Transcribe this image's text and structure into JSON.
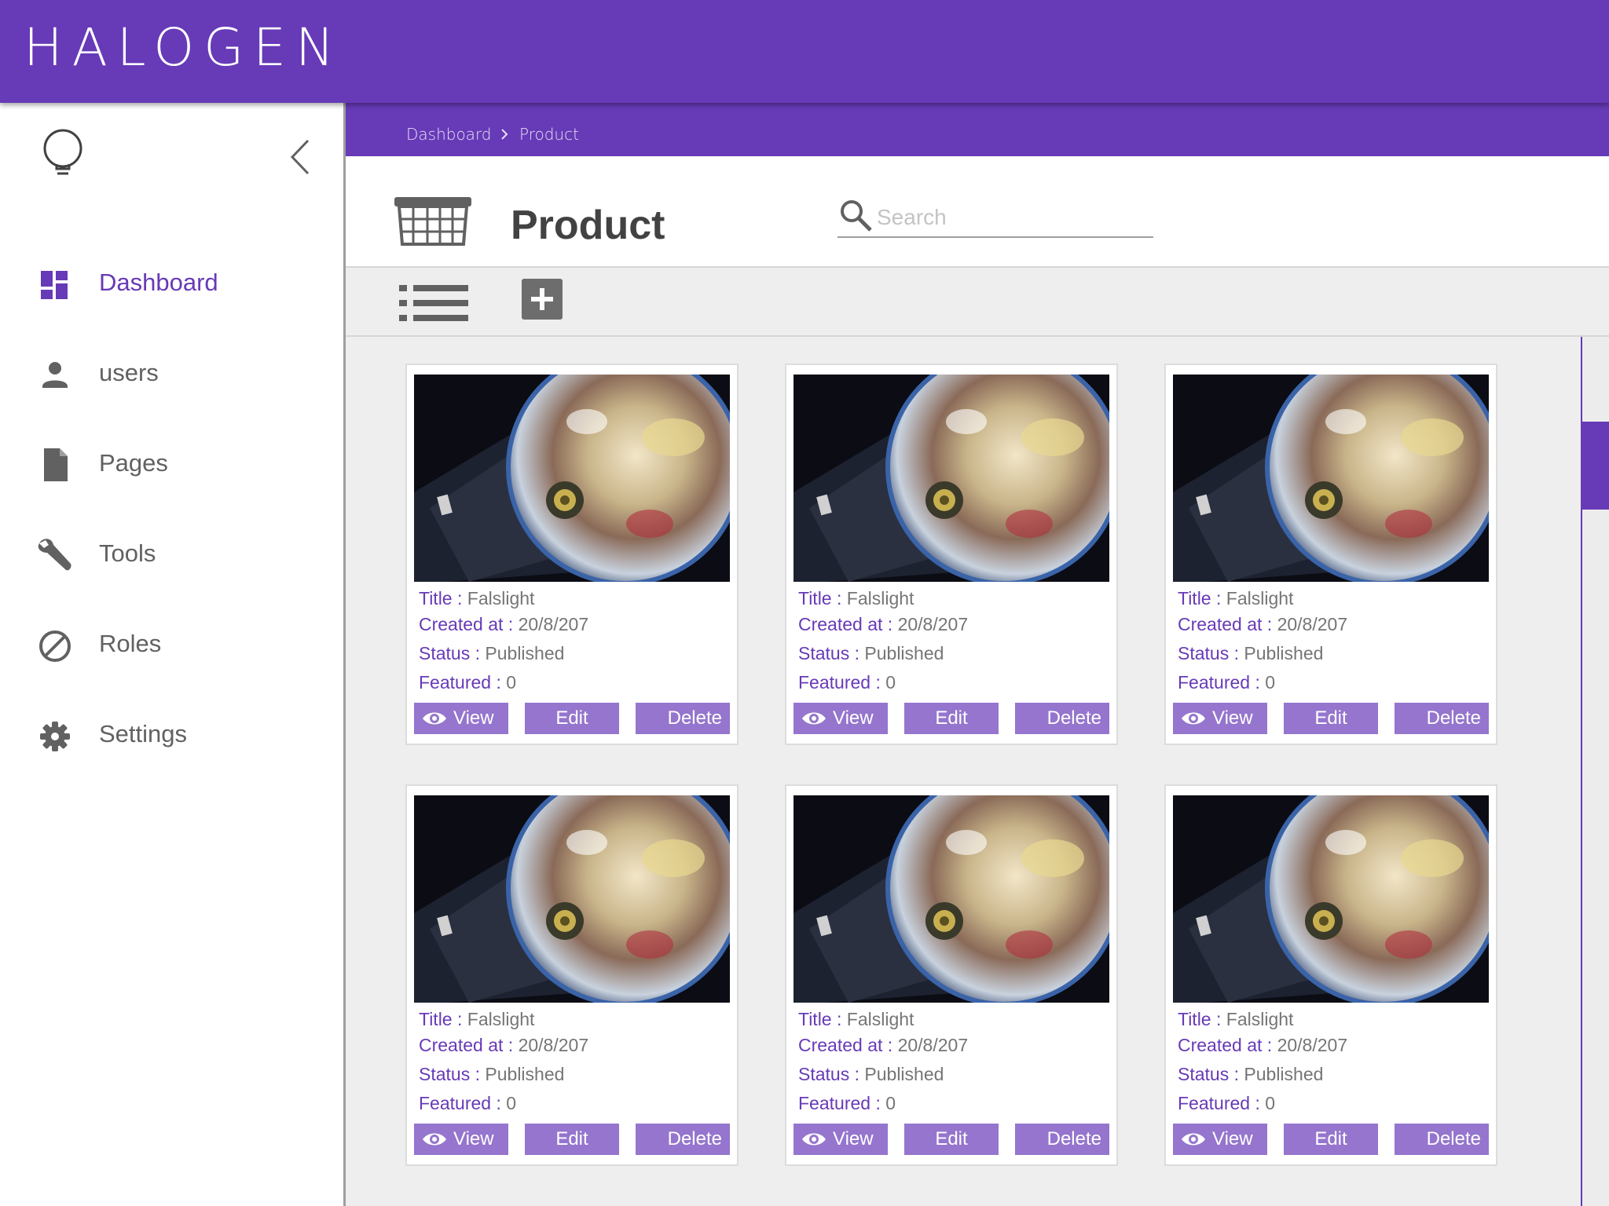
{
  "app": {
    "logo": "HALOGEN"
  },
  "sidebar": {
    "items": [
      {
        "label": "Dashboard",
        "icon": "dashboard-icon"
      },
      {
        "label": "users",
        "icon": "user-icon"
      },
      {
        "label": "Pages",
        "icon": "page-icon"
      },
      {
        "label": "Tools",
        "icon": "wrench-icon"
      },
      {
        "label": "Roles",
        "icon": "block-icon"
      },
      {
        "label": "Settings",
        "icon": "gear-icon"
      }
    ]
  },
  "breadcrumb": {
    "items": [
      "Dashboard",
      "Product"
    ]
  },
  "page": {
    "title": "Product"
  },
  "search": {
    "placeholder": "Search"
  },
  "field_labels": {
    "title": "Title",
    "created": "Created at",
    "status": "Status",
    "featured": "Featured",
    "sep": " : "
  },
  "actions": {
    "view": "View",
    "edit": "Edit",
    "delete": "Delete"
  },
  "cards": [
    {
      "title": "Falslight",
      "created": "20/8/207",
      "status": "Published",
      "featured": "0"
    },
    {
      "title": "Falslight",
      "created": "20/8/207",
      "status": "Published",
      "featured": "0"
    },
    {
      "title": "Falslight",
      "created": "20/8/207",
      "status": "Published",
      "featured": "0"
    },
    {
      "title": "Falslight",
      "created": "20/8/207",
      "status": "Published",
      "featured": "0"
    },
    {
      "title": "Falslight",
      "created": "20/8/207",
      "status": "Published",
      "featured": "0"
    },
    {
      "title": "Falslight",
      "created": "20/8/207",
      "status": "Published",
      "featured": "0"
    }
  ],
  "colors": {
    "brand": "#673ab7",
    "button": "#9575cd",
    "text_muted": "#757575"
  }
}
